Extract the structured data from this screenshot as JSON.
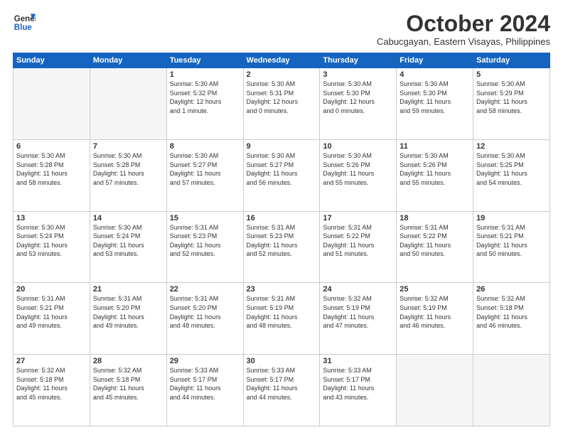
{
  "logo": {
    "line1": "General",
    "line2": "Blue"
  },
  "title": "October 2024",
  "subtitle": "Cabucgayan, Eastern Visayas, Philippines",
  "headers": [
    "Sunday",
    "Monday",
    "Tuesday",
    "Wednesday",
    "Thursday",
    "Friday",
    "Saturday"
  ],
  "weeks": [
    [
      {
        "day": "",
        "info": ""
      },
      {
        "day": "",
        "info": ""
      },
      {
        "day": "1",
        "info": "Sunrise: 5:30 AM\nSunset: 5:32 PM\nDaylight: 12 hours\nand 1 minute."
      },
      {
        "day": "2",
        "info": "Sunrise: 5:30 AM\nSunset: 5:31 PM\nDaylight: 12 hours\nand 0 minutes."
      },
      {
        "day": "3",
        "info": "Sunrise: 5:30 AM\nSunset: 5:30 PM\nDaylight: 12 hours\nand 0 minutes."
      },
      {
        "day": "4",
        "info": "Sunrise: 5:30 AM\nSunset: 5:30 PM\nDaylight: 11 hours\nand 59 minutes."
      },
      {
        "day": "5",
        "info": "Sunrise: 5:30 AM\nSunset: 5:29 PM\nDaylight: 11 hours\nand 58 minutes."
      }
    ],
    [
      {
        "day": "6",
        "info": "Sunrise: 5:30 AM\nSunset: 5:28 PM\nDaylight: 11 hours\nand 58 minutes."
      },
      {
        "day": "7",
        "info": "Sunrise: 5:30 AM\nSunset: 5:28 PM\nDaylight: 11 hours\nand 57 minutes."
      },
      {
        "day": "8",
        "info": "Sunrise: 5:30 AM\nSunset: 5:27 PM\nDaylight: 11 hours\nand 57 minutes."
      },
      {
        "day": "9",
        "info": "Sunrise: 5:30 AM\nSunset: 5:27 PM\nDaylight: 11 hours\nand 56 minutes."
      },
      {
        "day": "10",
        "info": "Sunrise: 5:30 AM\nSunset: 5:26 PM\nDaylight: 11 hours\nand 55 minutes."
      },
      {
        "day": "11",
        "info": "Sunrise: 5:30 AM\nSunset: 5:26 PM\nDaylight: 11 hours\nand 55 minutes."
      },
      {
        "day": "12",
        "info": "Sunrise: 5:30 AM\nSunset: 5:25 PM\nDaylight: 11 hours\nand 54 minutes."
      }
    ],
    [
      {
        "day": "13",
        "info": "Sunrise: 5:30 AM\nSunset: 5:24 PM\nDaylight: 11 hours\nand 53 minutes."
      },
      {
        "day": "14",
        "info": "Sunrise: 5:30 AM\nSunset: 5:24 PM\nDaylight: 11 hours\nand 53 minutes."
      },
      {
        "day": "15",
        "info": "Sunrise: 5:31 AM\nSunset: 5:23 PM\nDaylight: 11 hours\nand 52 minutes."
      },
      {
        "day": "16",
        "info": "Sunrise: 5:31 AM\nSunset: 5:23 PM\nDaylight: 11 hours\nand 52 minutes."
      },
      {
        "day": "17",
        "info": "Sunrise: 5:31 AM\nSunset: 5:22 PM\nDaylight: 11 hours\nand 51 minutes."
      },
      {
        "day": "18",
        "info": "Sunrise: 5:31 AM\nSunset: 5:22 PM\nDaylight: 11 hours\nand 50 minutes."
      },
      {
        "day": "19",
        "info": "Sunrise: 5:31 AM\nSunset: 5:21 PM\nDaylight: 11 hours\nand 50 minutes."
      }
    ],
    [
      {
        "day": "20",
        "info": "Sunrise: 5:31 AM\nSunset: 5:21 PM\nDaylight: 11 hours\nand 49 minutes."
      },
      {
        "day": "21",
        "info": "Sunrise: 5:31 AM\nSunset: 5:20 PM\nDaylight: 11 hours\nand 49 minutes."
      },
      {
        "day": "22",
        "info": "Sunrise: 5:31 AM\nSunset: 5:20 PM\nDaylight: 11 hours\nand 48 minutes."
      },
      {
        "day": "23",
        "info": "Sunrise: 5:31 AM\nSunset: 5:19 PM\nDaylight: 11 hours\nand 48 minutes."
      },
      {
        "day": "24",
        "info": "Sunrise: 5:32 AM\nSunset: 5:19 PM\nDaylight: 11 hours\nand 47 minutes."
      },
      {
        "day": "25",
        "info": "Sunrise: 5:32 AM\nSunset: 5:19 PM\nDaylight: 11 hours\nand 46 minutes."
      },
      {
        "day": "26",
        "info": "Sunrise: 5:32 AM\nSunset: 5:18 PM\nDaylight: 11 hours\nand 46 minutes."
      }
    ],
    [
      {
        "day": "27",
        "info": "Sunrise: 5:32 AM\nSunset: 5:18 PM\nDaylight: 11 hours\nand 45 minutes."
      },
      {
        "day": "28",
        "info": "Sunrise: 5:32 AM\nSunset: 5:18 PM\nDaylight: 11 hours\nand 45 minutes."
      },
      {
        "day": "29",
        "info": "Sunrise: 5:33 AM\nSunset: 5:17 PM\nDaylight: 11 hours\nand 44 minutes."
      },
      {
        "day": "30",
        "info": "Sunrise: 5:33 AM\nSunset: 5:17 PM\nDaylight: 11 hours\nand 44 minutes."
      },
      {
        "day": "31",
        "info": "Sunrise: 5:33 AM\nSunset: 5:17 PM\nDaylight: 11 hours\nand 43 minutes."
      },
      {
        "day": "",
        "info": ""
      },
      {
        "day": "",
        "info": ""
      }
    ]
  ]
}
